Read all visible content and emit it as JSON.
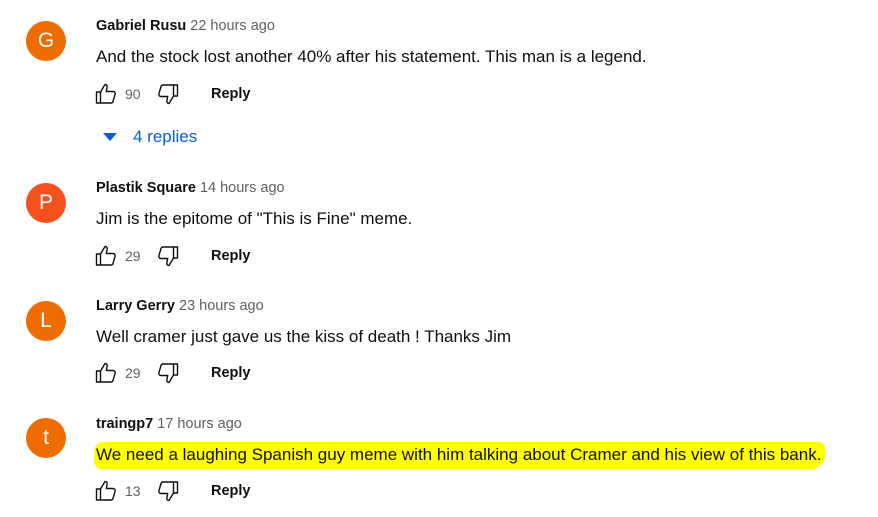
{
  "comments": [
    {
      "avatar_letter": "G",
      "avatar_color": "#ef6c00",
      "author": "Gabriel Rusu",
      "time": "22 hours ago",
      "text": "And the stock lost another 40% after his statement. This man is a legend.",
      "likes": "90",
      "reply_label": "Reply",
      "replies_label": "4 replies"
    },
    {
      "avatar_letter": "P",
      "avatar_color": "#f4511e",
      "author": "Plastik Square",
      "time": "14 hours ago",
      "text": "Jim is the epitome of \"This is Fine\" meme.",
      "likes": "29",
      "reply_label": "Reply"
    },
    {
      "avatar_letter": "L",
      "avatar_color": "#ef6c00",
      "author": "Larry Gerry",
      "time": "23 hours ago",
      "text": "Well cramer just gave us the kiss of death ! Thanks Jim",
      "likes": "29",
      "reply_label": "Reply"
    },
    {
      "avatar_letter": "t",
      "avatar_color": "#ef6c00",
      "author": "traingp7",
      "time": "17 hours ago",
      "text": "We need a laughing Spanish guy meme with him talking about Cramer and his view of this bank.",
      "likes": "13",
      "reply_label": "Reply",
      "highlight_color": "#ffff00"
    }
  ]
}
